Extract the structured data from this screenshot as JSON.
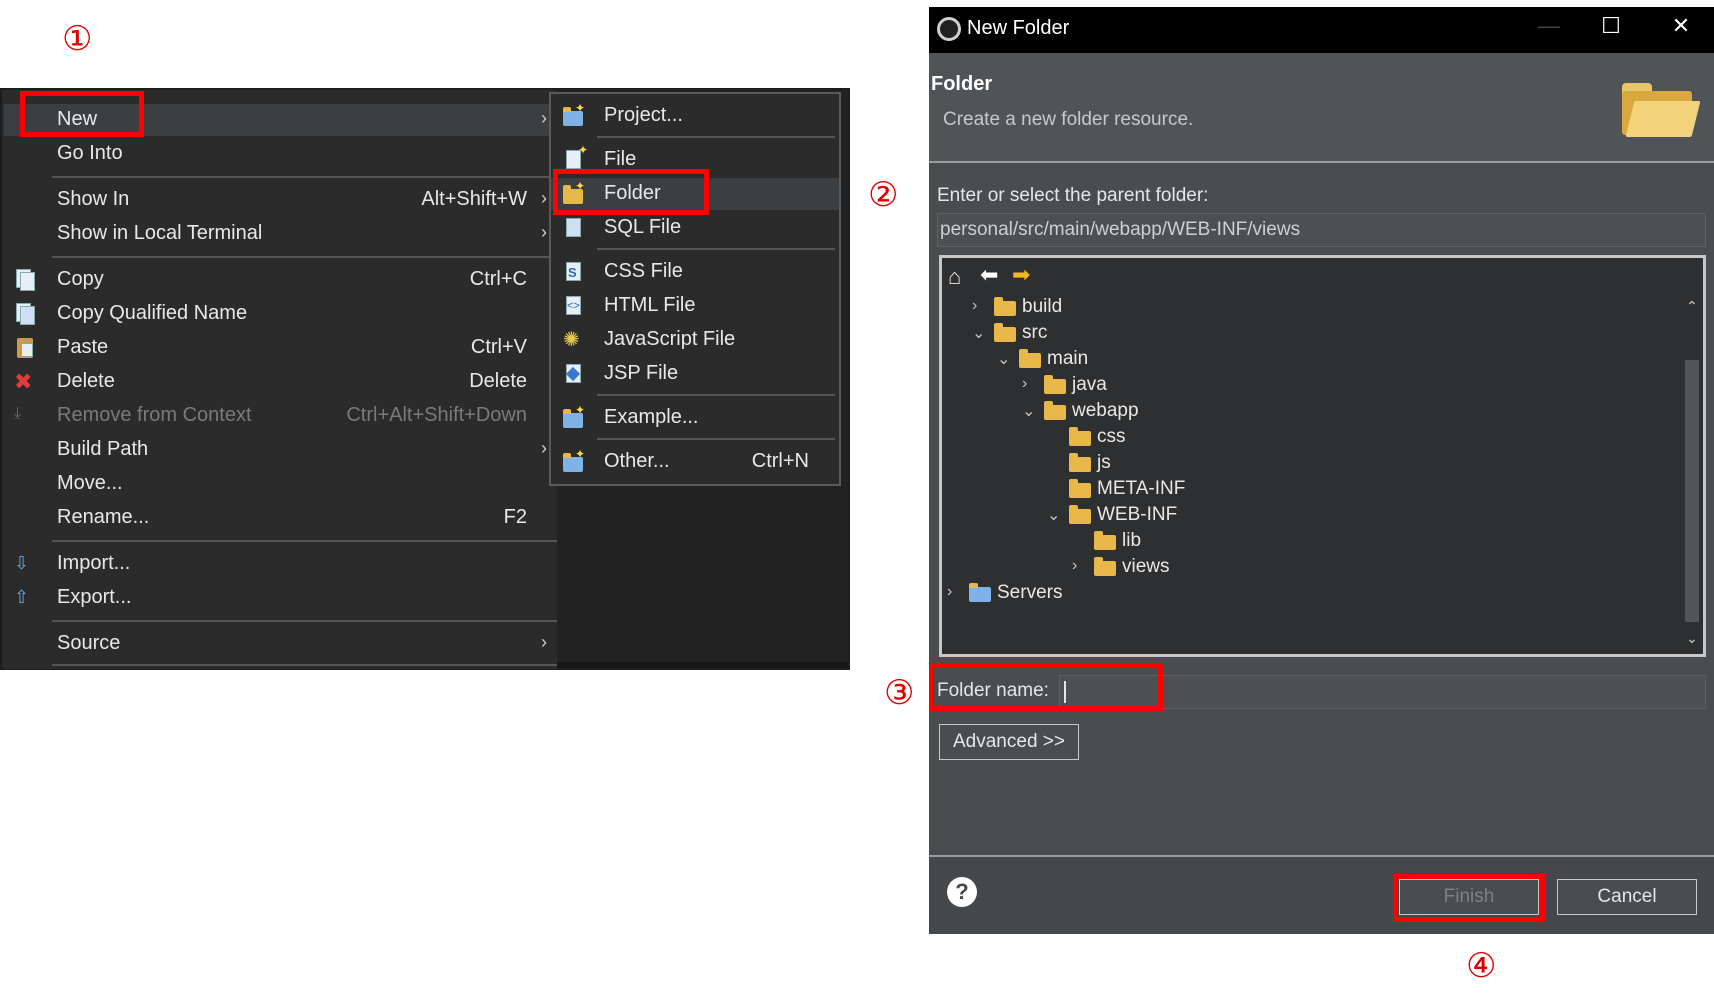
{
  "markers": {
    "one": "①",
    "two": "②",
    "three": "③",
    "four": "④"
  },
  "context_menu": {
    "items": [
      {
        "label": "New",
        "arrow": "›"
      },
      {
        "label": "Go Into"
      },
      {
        "label": "Show In",
        "shortcut": "Alt+Shift+W",
        "arrow": "›"
      },
      {
        "label": "Show in Local Terminal",
        "arrow": "›"
      },
      {
        "label": "Copy",
        "shortcut": "Ctrl+C",
        "icon": "copy-icon"
      },
      {
        "label": "Copy Qualified Name",
        "icon": "copy-qualified-icon"
      },
      {
        "label": "Paste",
        "shortcut": "Ctrl+V",
        "icon": "paste-icon"
      },
      {
        "label": "Delete",
        "shortcut": "Delete",
        "icon": "delete-icon"
      },
      {
        "label": "Remove from Context",
        "shortcut": "Ctrl+Alt+Shift+Down",
        "disabled": true
      },
      {
        "label": "Build Path",
        "arrow": "›"
      },
      {
        "label": "Move..."
      },
      {
        "label": "Rename...",
        "shortcut": "F2"
      },
      {
        "label": "Import...",
        "icon": "import-icon"
      },
      {
        "label": "Export...",
        "icon": "export-icon"
      },
      {
        "label": "Source",
        "arrow": "›"
      }
    ]
  },
  "submenu": {
    "items": [
      {
        "label": "Project..."
      },
      {
        "label": "File"
      },
      {
        "label": "Folder"
      },
      {
        "label": "SQL File"
      },
      {
        "label": "CSS File"
      },
      {
        "label": "HTML File"
      },
      {
        "label": "JavaScript File"
      },
      {
        "label": "JSP File"
      },
      {
        "label": "Example..."
      },
      {
        "label": "Other...",
        "shortcut": "Ctrl+N"
      }
    ]
  },
  "dialog": {
    "title": "New Folder",
    "window_controls": {
      "minimize": "—",
      "maximize": "☐",
      "close": "✕"
    },
    "header_title": "Folder",
    "header_desc": "Create a new folder resource.",
    "parent_label": "Enter or select the parent folder:",
    "parent_value": "personal/src/main/webapp/WEB-INF/views",
    "tree": [
      {
        "name": "build",
        "twisty": "›"
      },
      {
        "name": "src",
        "twisty": "⌄"
      },
      {
        "name": "main",
        "twisty": "⌄"
      },
      {
        "name": "java",
        "twisty": "›"
      },
      {
        "name": "webapp",
        "twisty": "⌄"
      },
      {
        "name": "css",
        "twisty": ""
      },
      {
        "name": "js",
        "twisty": ""
      },
      {
        "name": "META-INF",
        "twisty": ""
      },
      {
        "name": "WEB-INF",
        "twisty": "⌄"
      },
      {
        "name": "lib",
        "twisty": ""
      },
      {
        "name": "views",
        "twisty": "›"
      },
      {
        "name": "Servers",
        "twisty": "›"
      }
    ],
    "folder_name_label": "Folder name:",
    "folder_name_value": "",
    "advanced_label": "Advanced >>",
    "help": "?",
    "finish_label": "Finish",
    "cancel_label": "Cancel"
  }
}
